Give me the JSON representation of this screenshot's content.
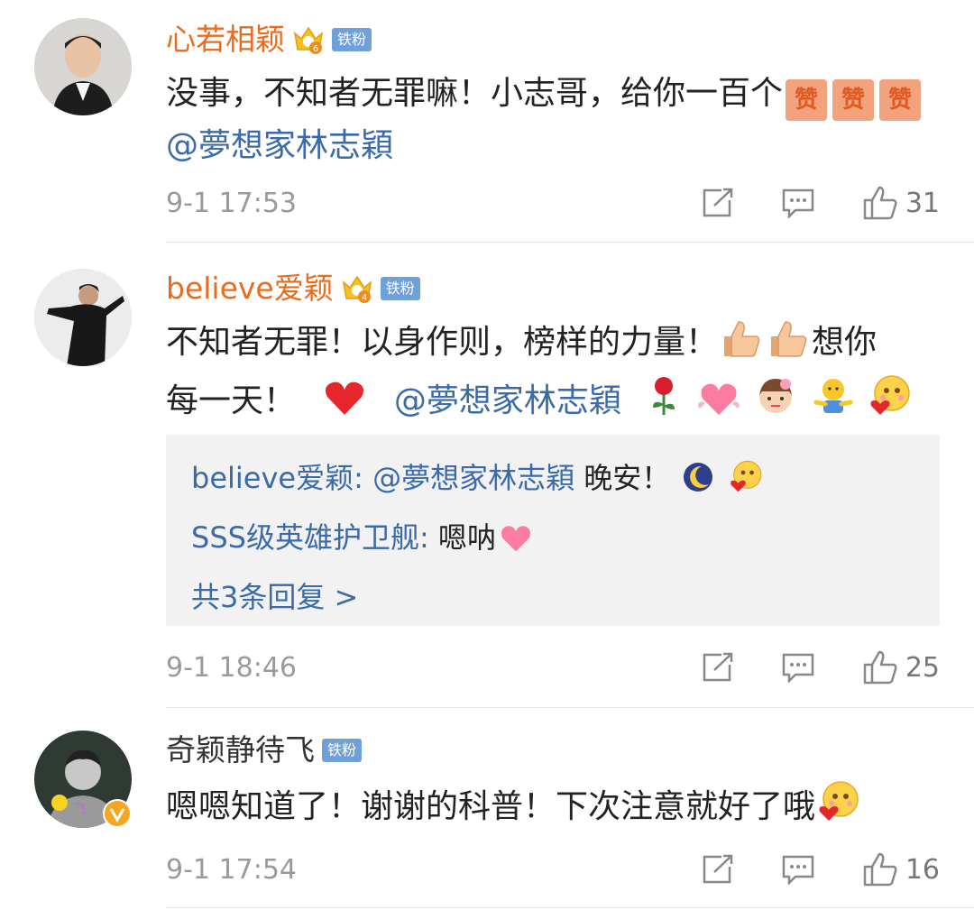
{
  "comments": [
    {
      "username": "心若相颖",
      "badge": "铁粉",
      "text_a": "没事，不知者无罪嘛！小志哥，给你一百个",
      "zan_label": "赞",
      "mention": "@夢想家林志穎",
      "time": "9-1 17:53",
      "likes": "31"
    },
    {
      "username": "believe爱颖",
      "badge": "铁粉",
      "text_a": "不知者无罪！以身作则，榜样的力量！",
      "text_b": "想你",
      "text_c": "每一天！",
      "mention": "@夢想家林志穎",
      "replies": [
        {
          "who": "believe爱颖",
          "sep": ": ",
          "mention": "@夢想家林志穎",
          "text": " 晚安！"
        },
        {
          "who": "SSS级英雄护卫舰",
          "sep": ": ",
          "text": "嗯呐"
        }
      ],
      "more_replies": "共3条回复 >",
      "time": "9-1 18:46",
      "likes": "25"
    },
    {
      "username": "奇颖静待飞",
      "badge": "铁粉",
      "text_a": "嗯嗯知道了！谢谢的科普！下次注意就好了哦",
      "time": "9-1 17:54",
      "likes": "16"
    }
  ],
  "colors": {
    "vip_name": "#eb6b1c",
    "link": "#3b6aa8",
    "badge_bg": "#6fa0d8",
    "meta": "#9a9a9a"
  }
}
